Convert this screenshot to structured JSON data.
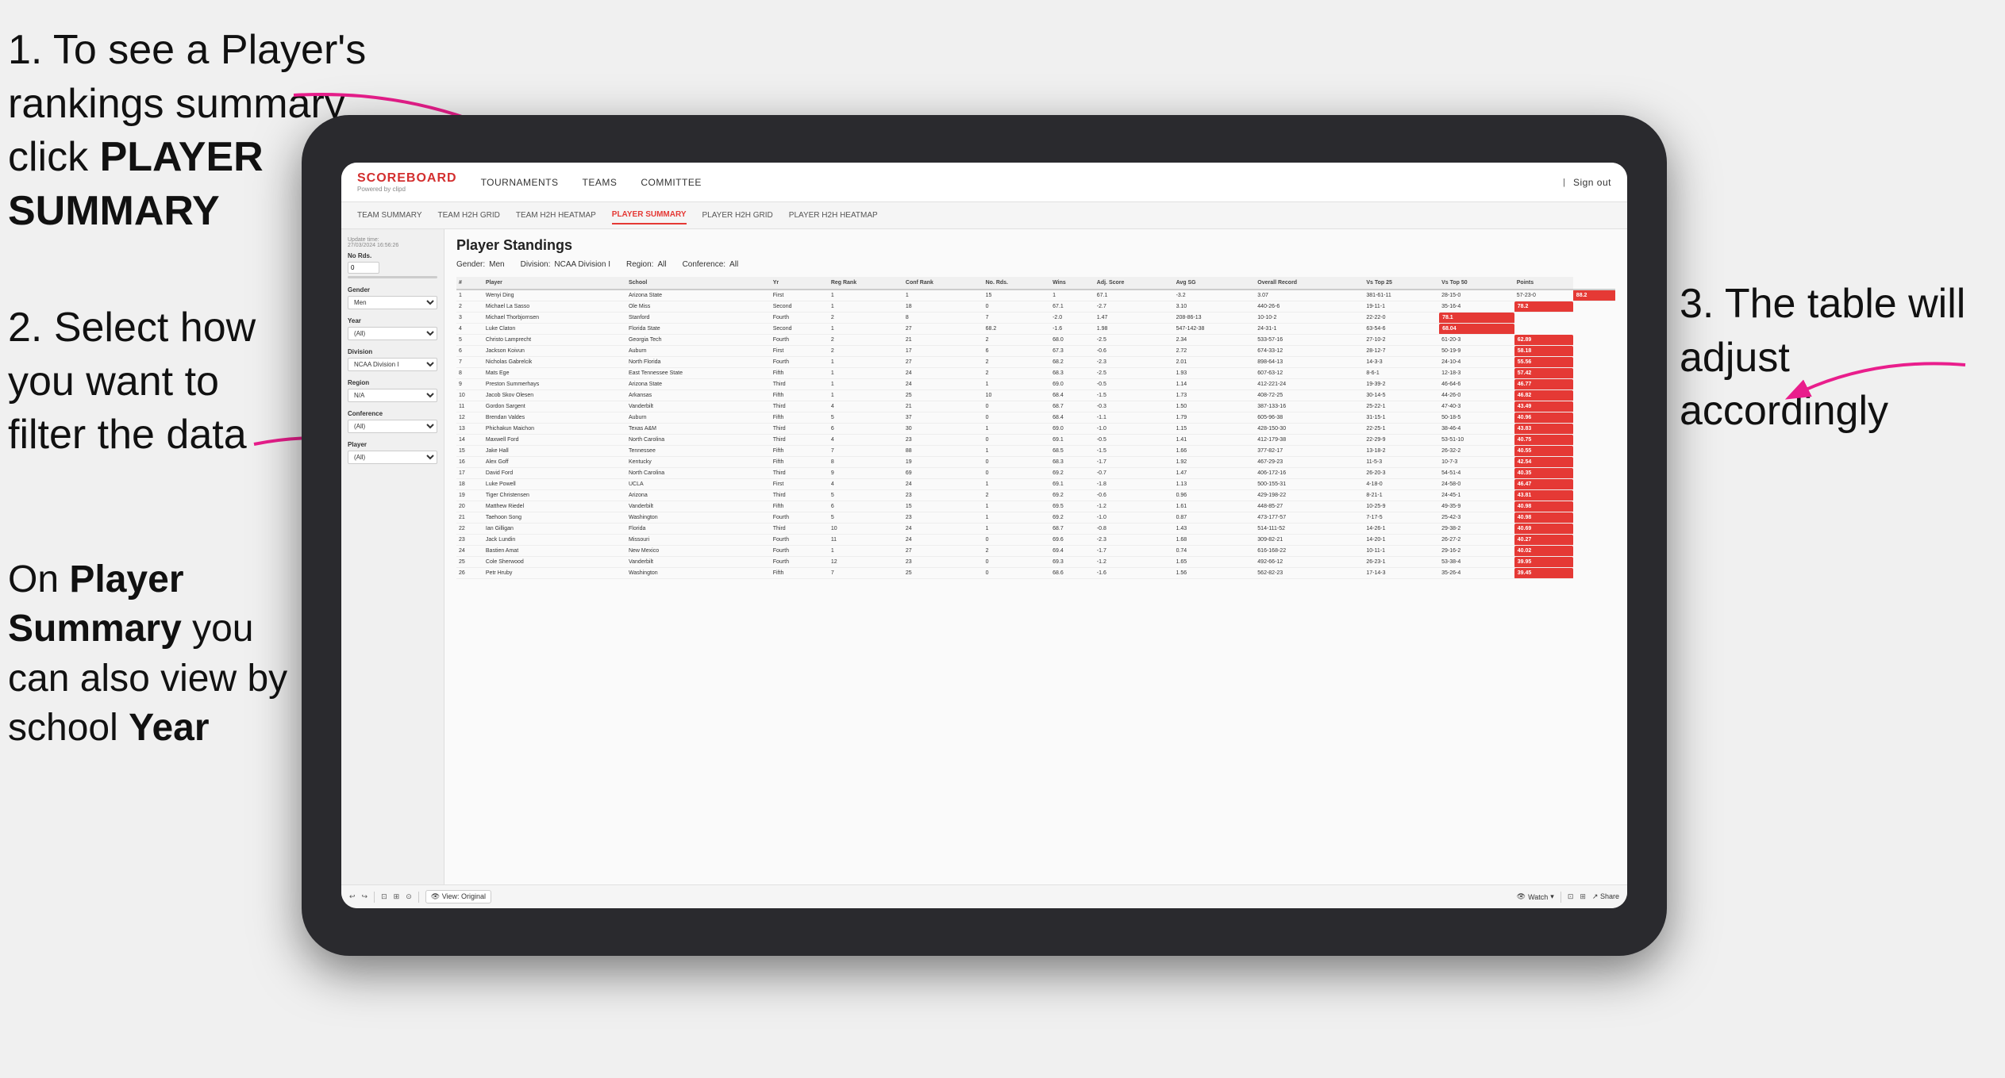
{
  "instructions": {
    "step1": "1. To see a Player's rankings summary click ",
    "step1_bold": "PLAYER SUMMARY",
    "step2_title": "2. Select how you want to filter the data",
    "step2_note_pre": "On ",
    "step2_bold1": "Player Summary",
    "step2_note_mid": " you can also view by school ",
    "step2_bold2": "Year",
    "step3": "3. The table will adjust accordingly"
  },
  "nav": {
    "logo": "SCOREBOARD",
    "logo_sub": "Powered by clipd",
    "items": [
      "TOURNAMENTS",
      "TEAMS",
      "COMMITTEE"
    ],
    "right": [
      "Sign out"
    ]
  },
  "subnav": {
    "items": [
      "TEAM SUMMARY",
      "TEAM H2H GRID",
      "TEAM H2H HEATMAP",
      "PLAYER SUMMARY",
      "PLAYER H2H GRID",
      "PLAYER H2H HEATMAP"
    ],
    "active": "PLAYER SUMMARY"
  },
  "sidebar": {
    "update_time_label": "Update time:",
    "update_time": "27/03/2024 16:56:26",
    "no_rds_label": "No Rds.",
    "gender_label": "Gender",
    "gender_value": "Men",
    "year_label": "Year",
    "year_value": "(All)",
    "division_label": "Division",
    "division_value": "NCAA Division I",
    "region_label": "Region",
    "region_value": "N/A",
    "conference_label": "Conference",
    "conference_value": "(All)",
    "player_label": "Player",
    "player_value": "(All)"
  },
  "table": {
    "title": "Player Standings",
    "filters": {
      "gender_label": "Gender:",
      "gender_val": "Men",
      "division_label": "Division:",
      "division_val": "NCAA Division I",
      "region_label": "Region:",
      "region_val": "All",
      "conference_label": "Conference:",
      "conference_val": "All"
    },
    "columns": [
      "#",
      "Player",
      "School",
      "Yr",
      "Reg Rank",
      "Conf Rank",
      "No. Rds.",
      "Wins",
      "Adj. Score to Par",
      "Avg SG",
      "Overall Record",
      "Vs Top 25",
      "Vs Top 50",
      "Points"
    ],
    "rows": [
      [
        "1",
        "Wenyi Ding",
        "Arizona State",
        "First",
        "1",
        "1",
        "15",
        "1",
        "67.1",
        "-3.2",
        "3.07",
        "381-61-11",
        "28-15-0",
        "57-23-0",
        "88.2"
      ],
      [
        "2",
        "Michael La Sasso",
        "Ole Miss",
        "Second",
        "1",
        "18",
        "0",
        "67.1",
        "-2.7",
        "3.10",
        "440-26-6",
        "19-11-1",
        "35-16-4",
        "78.2"
      ],
      [
        "3",
        "Michael Thorbjornsen",
        "Stanford",
        "Fourth",
        "2",
        "8",
        "7",
        "-2.0",
        "1.47",
        "208-86-13",
        "10-10-2",
        "22-22-0",
        "78.1"
      ],
      [
        "4",
        "Luke Claton",
        "Florida State",
        "Second",
        "1",
        "27",
        "68.2",
        "-1.6",
        "1.98",
        "547-142-38",
        "24-31-1",
        "63-54-6",
        "68.04"
      ],
      [
        "5",
        "Christo Lamprecht",
        "Georgia Tech",
        "Fourth",
        "2",
        "21",
        "2",
        "68.0",
        "-2.5",
        "2.34",
        "533-57-16",
        "27-10-2",
        "61-20-3",
        "62.89"
      ],
      [
        "6",
        "Jackson Koivun",
        "Auburn",
        "First",
        "2",
        "17",
        "6",
        "67.3",
        "-0.6",
        "2.72",
        "674-33-12",
        "28-12-7",
        "50-19-9",
        "58.18"
      ],
      [
        "7",
        "Nicholas Gabrelcik",
        "North Florida",
        "Fourth",
        "1",
        "27",
        "2",
        "68.2",
        "-2.3",
        "2.01",
        "898-64-13",
        "14-3-3",
        "24-10-4",
        "55.56"
      ],
      [
        "8",
        "Mats Ege",
        "East Tennessee State",
        "Fifth",
        "1",
        "24",
        "2",
        "68.3",
        "-2.5",
        "1.93",
        "607-63-12",
        "8-6-1",
        "12-18-3",
        "57.42"
      ],
      [
        "9",
        "Preston Summerhays",
        "Arizona State",
        "Third",
        "1",
        "24",
        "1",
        "69.0",
        "-0.5",
        "1.14",
        "412-221-24",
        "19-39-2",
        "46-64-6",
        "46.77"
      ],
      [
        "10",
        "Jacob Skov Olesen",
        "Arkansas",
        "Fifth",
        "1",
        "25",
        "10",
        "68.4",
        "-1.5",
        "1.73",
        "408-72-25",
        "30-14-5",
        "44-26-0",
        "46.82"
      ],
      [
        "11",
        "Gordon Sargent",
        "Vanderbilt",
        "Third",
        "4",
        "21",
        "0",
        "68.7",
        "-0.3",
        "1.50",
        "387-133-16",
        "25-22-1",
        "47-40-3",
        "43.49"
      ],
      [
        "12",
        "Brendan Valdes",
        "Auburn",
        "Fifth",
        "5",
        "37",
        "0",
        "68.4",
        "-1.1",
        "1.79",
        "605-96-38",
        "31-15-1",
        "50-18-5",
        "40.96"
      ],
      [
        "13",
        "Phichakun Maichon",
        "Texas A&M",
        "Third",
        "6",
        "30",
        "1",
        "69.0",
        "-1.0",
        "1.15",
        "428-150-30",
        "22-25-1",
        "38-46-4",
        "43.83"
      ],
      [
        "14",
        "Maxwell Ford",
        "North Carolina",
        "Third",
        "4",
        "23",
        "0",
        "69.1",
        "-0.5",
        "1.41",
        "412-179-38",
        "22-29-9",
        "53-51-10",
        "40.75"
      ],
      [
        "15",
        "Jake Hall",
        "Tennessee",
        "Fifth",
        "7",
        "88",
        "1",
        "68.5",
        "-1.5",
        "1.66",
        "377-82-17",
        "13-18-2",
        "26-32-2",
        "40.55"
      ],
      [
        "16",
        "Alex Goff",
        "Kentucky",
        "Fifth",
        "8",
        "19",
        "0",
        "68.3",
        "-1.7",
        "1.92",
        "467-29-23",
        "11-5-3",
        "10-7-3",
        "42.54"
      ],
      [
        "17",
        "David Ford",
        "North Carolina",
        "Third",
        "9",
        "69",
        "0",
        "69.2",
        "-0.7",
        "1.47",
        "406-172-16",
        "26-20-3",
        "54-51-4",
        "40.35"
      ],
      [
        "18",
        "Luke Powell",
        "UCLA",
        "First",
        "4",
        "24",
        "1",
        "69.1",
        "-1.8",
        "1.13",
        "500-155-31",
        "4-18-0",
        "24-58-0",
        "46.47"
      ],
      [
        "19",
        "Tiger Christensen",
        "Arizona",
        "Third",
        "5",
        "23",
        "2",
        "69.2",
        "-0.6",
        "0.96",
        "429-198-22",
        "8-21-1",
        "24-45-1",
        "43.81"
      ],
      [
        "20",
        "Matthew Riedel",
        "Vanderbilt",
        "Fifth",
        "6",
        "15",
        "1",
        "69.5",
        "-1.2",
        "1.61",
        "448-85-27",
        "10-25-9",
        "49-35-9",
        "40.98"
      ],
      [
        "21",
        "Taehoon Song",
        "Washington",
        "Fourth",
        "5",
        "23",
        "1",
        "69.2",
        "-1.0",
        "0.87",
        "473-177-57",
        "7-17-5",
        "25-42-3",
        "40.98"
      ],
      [
        "22",
        "Ian Gilligan",
        "Florida",
        "Third",
        "10",
        "24",
        "1",
        "68.7",
        "-0.8",
        "1.43",
        "514-111-52",
        "14-26-1",
        "29-38-2",
        "40.69"
      ],
      [
        "23",
        "Jack Lundin",
        "Missouri",
        "Fourth",
        "11",
        "24",
        "0",
        "69.6",
        "-2.3",
        "1.68",
        "309-82-21",
        "14-20-1",
        "26-27-2",
        "40.27"
      ],
      [
        "24",
        "Bastien Amat",
        "New Mexico",
        "Fourth",
        "1",
        "27",
        "2",
        "69.4",
        "-1.7",
        "0.74",
        "616-168-22",
        "10-11-1",
        "29-16-2",
        "40.02"
      ],
      [
        "25",
        "Cole Sherwood",
        "Vanderbilt",
        "Fourth",
        "12",
        "23",
        "0",
        "69.3",
        "-1.2",
        "1.65",
        "492-66-12",
        "26-23-1",
        "53-38-4",
        "39.95"
      ],
      [
        "26",
        "Petr Hruby",
        "Washington",
        "Fifth",
        "7",
        "25",
        "0",
        "68.6",
        "-1.6",
        "1.56",
        "562-82-23",
        "17-14-3",
        "35-26-4",
        "39.45"
      ]
    ]
  },
  "toolbar": {
    "view_label": "View: Original",
    "watch_label": "Watch",
    "share_label": "Share"
  }
}
